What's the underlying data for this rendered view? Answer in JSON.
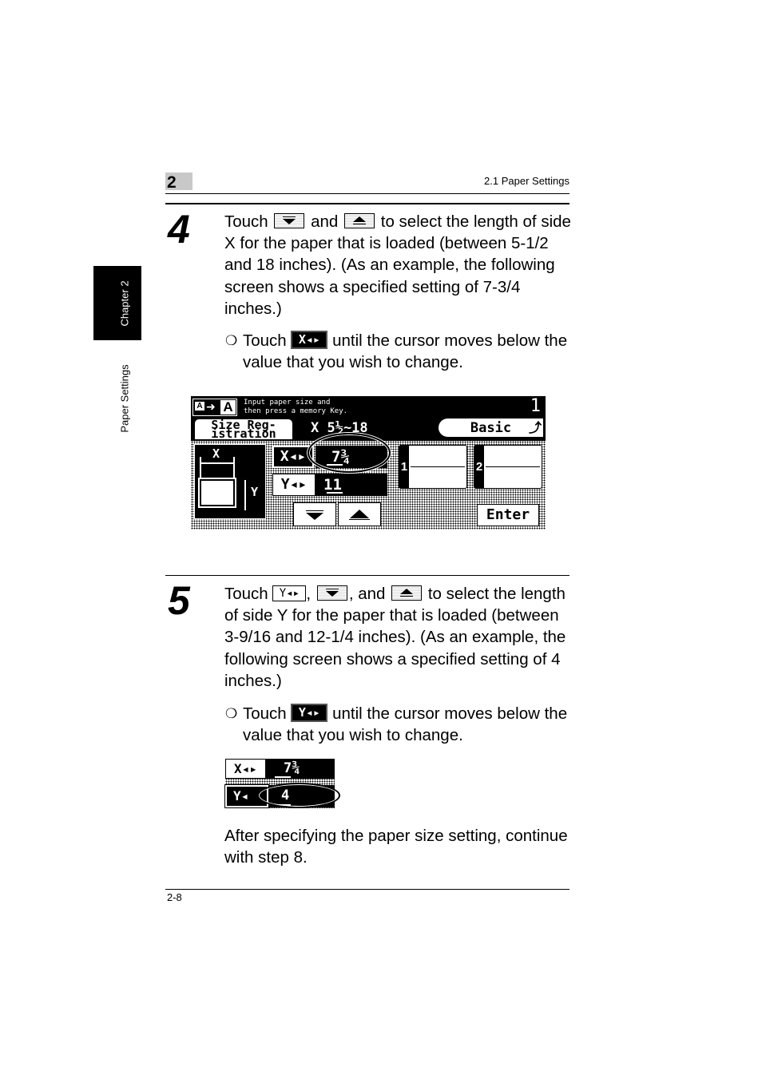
{
  "header": {
    "chapter_number": "2",
    "section_title": "2.1 Paper Settings"
  },
  "side_tab": {
    "chapter_label": "Chapter 2",
    "section_label": "Paper Settings"
  },
  "step4": {
    "number": "4",
    "text_part1": "Touch",
    "text_part2": "and",
    "text_part3": "to select the length of side X for the paper that is loaded (between 5-1/2 and 18 inches). (As an example, the following screen shows a specified setting of 7-3/4 inches.)",
    "bullet_mark": "❍",
    "bullet_part1": "Touch",
    "bullet_part2": "until the cursor moves below the value that you wish to change.",
    "inline_x_button_label": "X◂▸"
  },
  "screen1": {
    "message_line1": "Input paper size and",
    "message_line2": "then press a memory Key.",
    "page_indicator": "1",
    "tab_label_line1": "Size Reg-",
    "tab_label_line2": "istration",
    "range_label": "X 5½~18",
    "basic_button": "Basic",
    "diagram_x_label": "X",
    "diagram_y_label": "Y",
    "x_button_label": "X◂▸",
    "x_value": "7¾",
    "y_button_label": "Y◂▸",
    "y_value": "11",
    "memory_keys": [
      {
        "label": "1",
        "value": ""
      },
      {
        "label": "2",
        "value": ""
      }
    ],
    "enter_button": "Enter"
  },
  "step5": {
    "number": "5",
    "text_part1": "Touch",
    "text_part2": ",",
    "text_part3": ", and",
    "text_part4": "to select the length of side Y for the paper that is loaded (between 3-9/16 and 12-1/4 inches). (As an example, the following screen shows a specified setting of 4 inches.)",
    "bullet_mark": "❍",
    "bullet_part1": "Touch",
    "bullet_part2": "until the cursor moves below the value that you wish to change.",
    "inline_y_button_label": "Y◂▸",
    "after_text": "After specifying the paper size setting, continue with step 8."
  },
  "screen2": {
    "x_button_label": "X◂▸",
    "x_value": "7¾",
    "y_button_label": "Y◂",
    "y_value": "4"
  },
  "footer": {
    "page_number": "2-8"
  }
}
